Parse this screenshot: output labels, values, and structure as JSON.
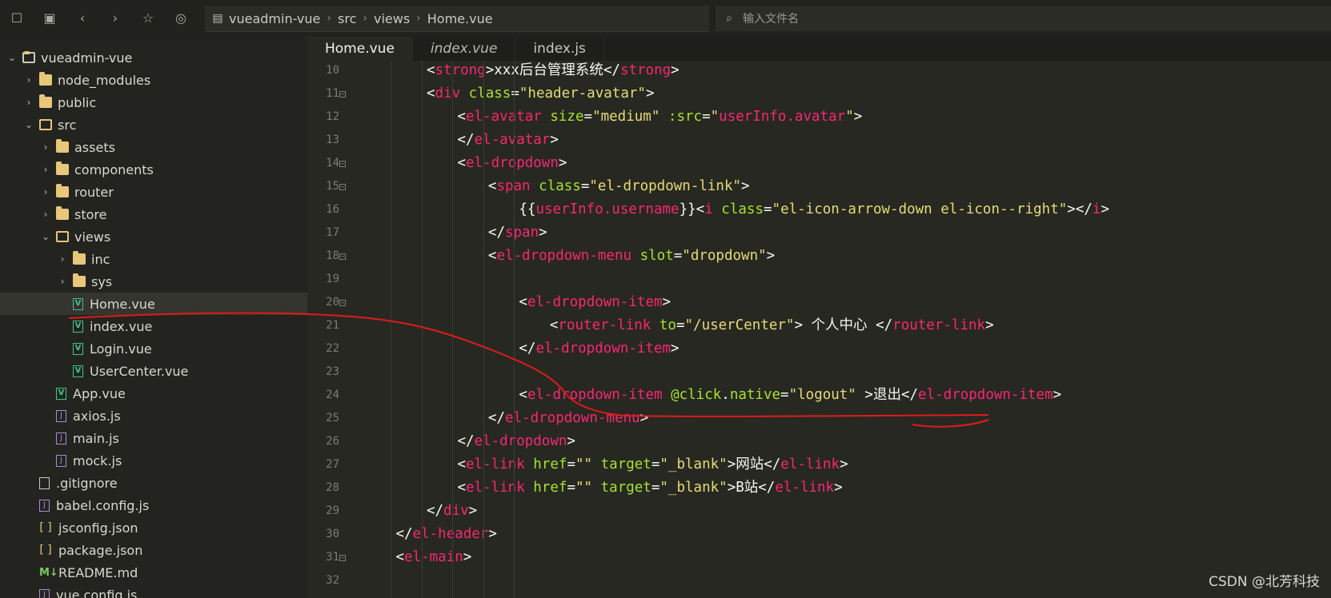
{
  "toolbar": {
    "icons": [
      "new-file-icon",
      "save-icon",
      "back-icon",
      "forward-icon",
      "star-icon",
      "run-icon"
    ],
    "breadcrumb": [
      "vueadmin-vue",
      "src",
      "views",
      "Home.vue"
    ],
    "search_placeholder": "输入文件名"
  },
  "sidebar": {
    "items": [
      {
        "label": "vueadmin-vue",
        "type": "root",
        "depth": 0,
        "expanded": true
      },
      {
        "label": "node_modules",
        "type": "folder",
        "depth": 1,
        "expanded": false
      },
      {
        "label": "public",
        "type": "folder",
        "depth": 1,
        "expanded": false
      },
      {
        "label": "src",
        "type": "folder",
        "depth": 1,
        "expanded": true
      },
      {
        "label": "assets",
        "type": "folder",
        "depth": 2,
        "expanded": false
      },
      {
        "label": "components",
        "type": "folder",
        "depth": 2,
        "expanded": false
      },
      {
        "label": "router",
        "type": "folder",
        "depth": 2,
        "expanded": false
      },
      {
        "label": "store",
        "type": "folder",
        "depth": 2,
        "expanded": false
      },
      {
        "label": "views",
        "type": "folder",
        "depth": 2,
        "expanded": true
      },
      {
        "label": "inc",
        "type": "folder",
        "depth": 3,
        "expanded": false
      },
      {
        "label": "sys",
        "type": "folder",
        "depth": 3,
        "expanded": false
      },
      {
        "label": "Home.vue",
        "type": "vue",
        "depth": 3,
        "selected": true
      },
      {
        "label": "index.vue",
        "type": "vue",
        "depth": 3
      },
      {
        "label": "Login.vue",
        "type": "vue",
        "depth": 3
      },
      {
        "label": "UserCenter.vue",
        "type": "vue",
        "depth": 3
      },
      {
        "label": "App.vue",
        "type": "vue",
        "depth": 2
      },
      {
        "label": "axios.js",
        "type": "js",
        "depth": 2
      },
      {
        "label": "main.js",
        "type": "js",
        "depth": 2
      },
      {
        "label": "mock.js",
        "type": "js",
        "depth": 2
      },
      {
        "label": ".gitignore",
        "type": "file",
        "depth": 1
      },
      {
        "label": "babel.config.js",
        "type": "js",
        "depth": 1
      },
      {
        "label": "jsconfig.json",
        "type": "json",
        "depth": 1
      },
      {
        "label": "package.json",
        "type": "json",
        "depth": 1
      },
      {
        "label": "README.md",
        "type": "md",
        "depth": 1
      },
      {
        "label": "vue.config.js",
        "type": "js",
        "depth": 1
      }
    ]
  },
  "tabs": [
    {
      "label": "Home.vue",
      "active": true,
      "italic": false
    },
    {
      "label": "index.vue",
      "active": false,
      "italic": true
    },
    {
      "label": "index.js",
      "active": false,
      "italic": false
    }
  ],
  "code": [
    {
      "n": "10",
      "indent": 4,
      "fold": false,
      "tokens": [
        [
          "p",
          "<"
        ],
        [
          "t",
          "strong"
        ],
        [
          "p",
          ">xxx后台管理系统</"
        ],
        [
          "t",
          "strong"
        ],
        [
          "p",
          ">"
        ]
      ]
    },
    {
      "n": "11",
      "indent": 4,
      "fold": true,
      "tokens": [
        [
          "p",
          "<"
        ],
        [
          "t",
          "div"
        ],
        [
          "p",
          " "
        ],
        [
          "a",
          "class"
        ],
        [
          "p",
          "="
        ],
        [
          "s",
          "\"header-avatar\""
        ],
        [
          "p",
          ">"
        ]
      ]
    },
    {
      "n": "12",
      "indent": 5,
      "fold": false,
      "tokens": [
        [
          "p",
          "<"
        ],
        [
          "t",
          "el-avatar"
        ],
        [
          "p",
          " "
        ],
        [
          "a",
          "size"
        ],
        [
          "p",
          "="
        ],
        [
          "s",
          "\"medium\""
        ],
        [
          "p",
          " "
        ],
        [
          "a",
          ":src"
        ],
        [
          "p",
          "="
        ],
        [
          "s",
          "\""
        ],
        [
          "t",
          "userInfo.avatar"
        ],
        [
          "s",
          "\""
        ],
        [
          "p",
          ">"
        ]
      ]
    },
    {
      "n": "13",
      "indent": 5,
      "fold": false,
      "tokens": [
        [
          "p",
          "</"
        ],
        [
          "t",
          "el-avatar"
        ],
        [
          "p",
          ">"
        ]
      ]
    },
    {
      "n": "14",
      "indent": 5,
      "fold": true,
      "tokens": [
        [
          "p",
          "<"
        ],
        [
          "t",
          "el-dropdown"
        ],
        [
          "p",
          ">"
        ]
      ]
    },
    {
      "n": "15",
      "indent": 6,
      "fold": true,
      "tokens": [
        [
          "p",
          "<"
        ],
        [
          "t",
          "span"
        ],
        [
          "p",
          " "
        ],
        [
          "a",
          "class"
        ],
        [
          "p",
          "="
        ],
        [
          "s",
          "\"el-dropdown-link\""
        ],
        [
          "p",
          ">"
        ]
      ]
    },
    {
      "n": "16",
      "indent": 7,
      "fold": false,
      "tokens": [
        [
          "p",
          "{{"
        ],
        [
          "t",
          "userInfo.username"
        ],
        [
          "p",
          "}}<"
        ],
        [
          "t",
          "i"
        ],
        [
          "p",
          " "
        ],
        [
          "a",
          "class"
        ],
        [
          "p",
          "="
        ],
        [
          "s",
          "\"el-icon-arrow-down el-icon--right\""
        ],
        [
          "p",
          "></"
        ],
        [
          "t",
          "i"
        ],
        [
          "p",
          ">"
        ]
      ]
    },
    {
      "n": "17",
      "indent": 6,
      "fold": false,
      "tokens": [
        [
          "p",
          "</"
        ],
        [
          "t",
          "span"
        ],
        [
          "p",
          ">"
        ]
      ]
    },
    {
      "n": "18",
      "indent": 6,
      "fold": true,
      "tokens": [
        [
          "p",
          "<"
        ],
        [
          "t",
          "el-dropdown-menu"
        ],
        [
          "p",
          " "
        ],
        [
          "a",
          "slot"
        ],
        [
          "p",
          "="
        ],
        [
          "s",
          "\"dropdown\""
        ],
        [
          "p",
          ">"
        ]
      ]
    },
    {
      "n": "19",
      "indent": 7,
      "fold": false,
      "tokens": []
    },
    {
      "n": "20",
      "indent": 7,
      "fold": true,
      "tokens": [
        [
          "p",
          "<"
        ],
        [
          "t",
          "el-dropdown-item"
        ],
        [
          "p",
          ">"
        ]
      ]
    },
    {
      "n": "21",
      "indent": 8,
      "fold": false,
      "tokens": [
        [
          "p",
          "<"
        ],
        [
          "t",
          "router-link"
        ],
        [
          "p",
          " "
        ],
        [
          "a",
          "to"
        ],
        [
          "p",
          "="
        ],
        [
          "s",
          "\"/userCenter\""
        ],
        [
          "p",
          "> 个人中心 </"
        ],
        [
          "t",
          "router-link"
        ],
        [
          "p",
          ">"
        ]
      ]
    },
    {
      "n": "22",
      "indent": 7,
      "fold": false,
      "tokens": [
        [
          "p",
          "</"
        ],
        [
          "t",
          "el-dropdown-item"
        ],
        [
          "p",
          ">"
        ]
      ]
    },
    {
      "n": "23",
      "indent": 7,
      "fold": false,
      "tokens": []
    },
    {
      "n": "24",
      "indent": 7,
      "fold": false,
      "tokens": [
        [
          "p",
          "<"
        ],
        [
          "t",
          "el-dropdown-item"
        ],
        [
          "p",
          " "
        ],
        [
          "a",
          "@click"
        ],
        [
          "p",
          "."
        ],
        [
          "a",
          "native"
        ],
        [
          "p",
          "="
        ],
        [
          "s",
          "\"logout\""
        ],
        [
          "p",
          " >退出</"
        ],
        [
          "t",
          "el-dropdown-item"
        ],
        [
          "p",
          ">"
        ]
      ]
    },
    {
      "n": "25",
      "indent": 6,
      "fold": false,
      "tokens": [
        [
          "p",
          "</"
        ],
        [
          "t",
          "el-dropdown-menu"
        ],
        [
          "p",
          ">"
        ]
      ]
    },
    {
      "n": "26",
      "indent": 5,
      "fold": false,
      "tokens": [
        [
          "p",
          "</"
        ],
        [
          "t",
          "el-dropdown"
        ],
        [
          "p",
          ">"
        ]
      ]
    },
    {
      "n": "27",
      "indent": 5,
      "fold": false,
      "tokens": [
        [
          "p",
          "<"
        ],
        [
          "t",
          "el-link"
        ],
        [
          "p",
          " "
        ],
        [
          "a",
          "href"
        ],
        [
          "p",
          "="
        ],
        [
          "s",
          "\"\""
        ],
        [
          "p",
          " "
        ],
        [
          "a",
          "target"
        ],
        [
          "p",
          "="
        ],
        [
          "s",
          "\"_blank\""
        ],
        [
          "p",
          ">网站</"
        ],
        [
          "t",
          "el-link"
        ],
        [
          "p",
          ">"
        ]
      ]
    },
    {
      "n": "28",
      "indent": 5,
      "fold": false,
      "tokens": [
        [
          "p",
          "<"
        ],
        [
          "t",
          "el-link"
        ],
        [
          "p",
          " "
        ],
        [
          "a",
          "href"
        ],
        [
          "p",
          "="
        ],
        [
          "s",
          "\"\""
        ],
        [
          "p",
          " "
        ],
        [
          "a",
          "target"
        ],
        [
          "p",
          "="
        ],
        [
          "s",
          "\"_blank\""
        ],
        [
          "p",
          ">B站</"
        ],
        [
          "t",
          "el-link"
        ],
        [
          "p",
          ">"
        ]
      ]
    },
    {
      "n": "29",
      "indent": 4,
      "fold": false,
      "tokens": [
        [
          "p",
          "</"
        ],
        [
          "t",
          "div"
        ],
        [
          "p",
          ">"
        ]
      ]
    },
    {
      "n": "30",
      "indent": 3,
      "fold": false,
      "tokens": [
        [
          "p",
          "</"
        ],
        [
          "t",
          "el-header"
        ],
        [
          "p",
          ">"
        ]
      ]
    },
    {
      "n": "31",
      "indent": 3,
      "fold": true,
      "tokens": [
        [
          "p",
          "<"
        ],
        [
          "t",
          "el-main"
        ],
        [
          "p",
          ">"
        ]
      ]
    },
    {
      "n": "32",
      "indent": 4,
      "fold": false,
      "tokens": []
    }
  ],
  "watermark": "CSDN @北芳科技",
  "colors": {
    "tag": "#f92672",
    "attr": "#a6e22e",
    "string": "#e6db74",
    "annotation": "#e01b1b"
  }
}
